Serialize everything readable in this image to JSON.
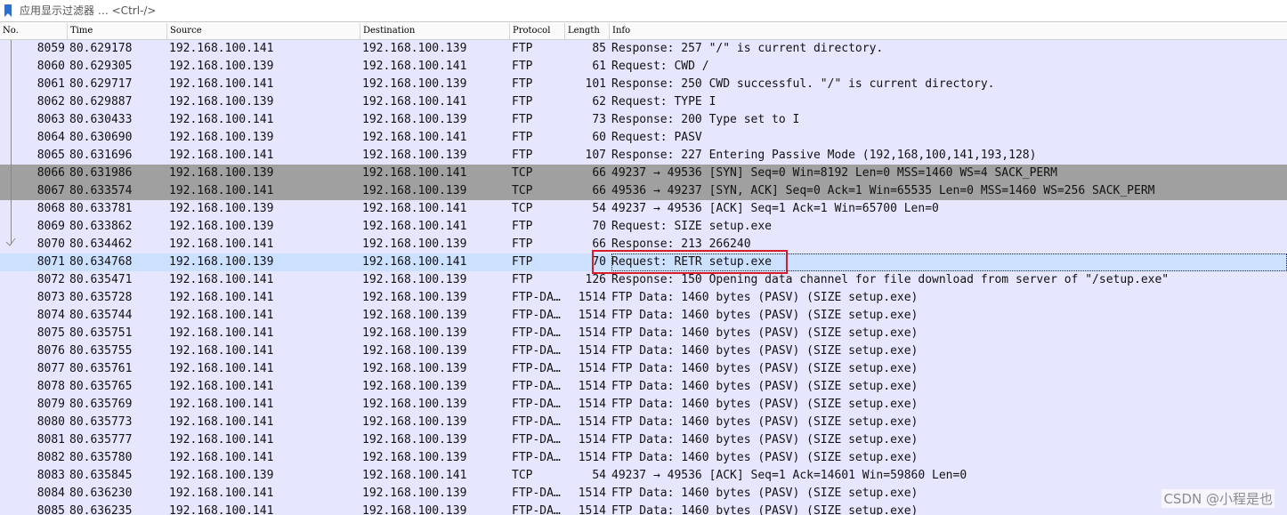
{
  "filter": {
    "placeholder": "应用显示过滤器 … <Ctrl-/>"
  },
  "columns": [
    "No.",
    "Time",
    "Source",
    "Destination",
    "Protocol",
    "Length",
    "Info"
  ],
  "packets": [
    {
      "no": "8059",
      "time": "80.629178",
      "src": "192.168.100.141",
      "dst": "192.168.100.139",
      "proto": "FTP",
      "len": "85",
      "info": "Response: 257 \"/\" is current directory."
    },
    {
      "no": "8060",
      "time": "80.629305",
      "src": "192.168.100.139",
      "dst": "192.168.100.141",
      "proto": "FTP",
      "len": "61",
      "info": "Request: CWD /"
    },
    {
      "no": "8061",
      "time": "80.629717",
      "src": "192.168.100.141",
      "dst": "192.168.100.139",
      "proto": "FTP",
      "len": "101",
      "info": "Response: 250 CWD successful. \"/\" is current directory."
    },
    {
      "no": "8062",
      "time": "80.629887",
      "src": "192.168.100.139",
      "dst": "192.168.100.141",
      "proto": "FTP",
      "len": "62",
      "info": "Request: TYPE I"
    },
    {
      "no": "8063",
      "time": "80.630433",
      "src": "192.168.100.141",
      "dst": "192.168.100.139",
      "proto": "FTP",
      "len": "73",
      "info": "Response: 200 Type set to I"
    },
    {
      "no": "8064",
      "time": "80.630690",
      "src": "192.168.100.139",
      "dst": "192.168.100.141",
      "proto": "FTP",
      "len": "60",
      "info": "Request: PASV"
    },
    {
      "no": "8065",
      "time": "80.631696",
      "src": "192.168.100.141",
      "dst": "192.168.100.139",
      "proto": "FTP",
      "len": "107",
      "info": "Response: 227 Entering Passive Mode (192,168,100,141,193,128)"
    },
    {
      "no": "8066",
      "time": "80.631986",
      "src": "192.168.100.139",
      "dst": "192.168.100.141",
      "proto": "TCP",
      "len": "66",
      "info": "49237 → 49536 [SYN] Seq=0 Win=8192 Len=0 MSS=1460 WS=4 SACK_PERM"
    },
    {
      "no": "8067",
      "time": "80.633574",
      "src": "192.168.100.141",
      "dst": "192.168.100.139",
      "proto": "TCP",
      "len": "66",
      "info": "49536 → 49237 [SYN, ACK] Seq=0 Ack=1 Win=65535 Len=0 MSS=1460 WS=256 SACK_PERM"
    },
    {
      "no": "8068",
      "time": "80.633781",
      "src": "192.168.100.139",
      "dst": "192.168.100.141",
      "proto": "TCP",
      "len": "54",
      "info": "49237 → 49536 [ACK] Seq=1 Ack=1 Win=65700 Len=0"
    },
    {
      "no": "8069",
      "time": "80.633862",
      "src": "192.168.100.139",
      "dst": "192.168.100.141",
      "proto": "FTP",
      "len": "70",
      "info": "Request: SIZE setup.exe"
    },
    {
      "no": "8070",
      "time": "80.634462",
      "src": "192.168.100.141",
      "dst": "192.168.100.139",
      "proto": "FTP",
      "len": "66",
      "info": "Response: 213 266240"
    },
    {
      "no": "8071",
      "time": "80.634768",
      "src": "192.168.100.139",
      "dst": "192.168.100.141",
      "proto": "FTP",
      "len": "70",
      "info": "Request: RETR setup.exe"
    },
    {
      "no": "8072",
      "time": "80.635471",
      "src": "192.168.100.141",
      "dst": "192.168.100.139",
      "proto": "FTP",
      "len": "126",
      "info": "Response: 150 Opening data channel for file download from server of \"/setup.exe\""
    },
    {
      "no": "8073",
      "time": "80.635728",
      "src": "192.168.100.141",
      "dst": "192.168.100.139",
      "proto": "FTP-DA…",
      "len": "1514",
      "info": "FTP Data: 1460 bytes (PASV) (SIZE setup.exe)"
    },
    {
      "no": "8074",
      "time": "80.635744",
      "src": "192.168.100.141",
      "dst": "192.168.100.139",
      "proto": "FTP-DA…",
      "len": "1514",
      "info": "FTP Data: 1460 bytes (PASV) (SIZE setup.exe)"
    },
    {
      "no": "8075",
      "time": "80.635751",
      "src": "192.168.100.141",
      "dst": "192.168.100.139",
      "proto": "FTP-DA…",
      "len": "1514",
      "info": "FTP Data: 1460 bytes (PASV) (SIZE setup.exe)"
    },
    {
      "no": "8076",
      "time": "80.635755",
      "src": "192.168.100.141",
      "dst": "192.168.100.139",
      "proto": "FTP-DA…",
      "len": "1514",
      "info": "FTP Data: 1460 bytes (PASV) (SIZE setup.exe)"
    },
    {
      "no": "8077",
      "time": "80.635761",
      "src": "192.168.100.141",
      "dst": "192.168.100.139",
      "proto": "FTP-DA…",
      "len": "1514",
      "info": "FTP Data: 1460 bytes (PASV) (SIZE setup.exe)"
    },
    {
      "no": "8078",
      "time": "80.635765",
      "src": "192.168.100.141",
      "dst": "192.168.100.139",
      "proto": "FTP-DA…",
      "len": "1514",
      "info": "FTP Data: 1460 bytes (PASV) (SIZE setup.exe)"
    },
    {
      "no": "8079",
      "time": "80.635769",
      "src": "192.168.100.141",
      "dst": "192.168.100.139",
      "proto": "FTP-DA…",
      "len": "1514",
      "info": "FTP Data: 1460 bytes (PASV) (SIZE setup.exe)"
    },
    {
      "no": "8080",
      "time": "80.635773",
      "src": "192.168.100.141",
      "dst": "192.168.100.139",
      "proto": "FTP-DA…",
      "len": "1514",
      "info": "FTP Data: 1460 bytes (PASV) (SIZE setup.exe)"
    },
    {
      "no": "8081",
      "time": "80.635777",
      "src": "192.168.100.141",
      "dst": "192.168.100.139",
      "proto": "FTP-DA…",
      "len": "1514",
      "info": "FTP Data: 1460 bytes (PASV) (SIZE setup.exe)"
    },
    {
      "no": "8082",
      "time": "80.635780",
      "src": "192.168.100.141",
      "dst": "192.168.100.139",
      "proto": "FTP-DA…",
      "len": "1514",
      "info": "FTP Data: 1460 bytes (PASV) (SIZE setup.exe)"
    },
    {
      "no": "8083",
      "time": "80.635845",
      "src": "192.168.100.139",
      "dst": "192.168.100.141",
      "proto": "TCP",
      "len": "54",
      "info": "49237 → 49536 [ACK] Seq=1 Ack=14601 Win=59860 Len=0"
    },
    {
      "no": "8084",
      "time": "80.636230",
      "src": "192.168.100.141",
      "dst": "192.168.100.139",
      "proto": "FTP-DA…",
      "len": "1514",
      "info": "FTP Data: 1460 bytes (PASV) (SIZE setup.exe)"
    },
    {
      "no": "8085",
      "time": "80.636235",
      "src": "192.168.100.141",
      "dst": "192.168.100.139",
      "proto": "FTP-DA…",
      "len": "1514",
      "info": "FTP Data: 1460 bytes (PASV) (SIZE setup.exe)"
    }
  ],
  "selected_no": "8071",
  "syn_rows": [
    "8066",
    "8067"
  ],
  "watermark": "CSDN @小程是也",
  "colors": {
    "row_bg": "#e7e6ff",
    "syn_bg": "#a0a0a0",
    "selected_bg": "#cce0ff",
    "highlight_border": "#d91c2a",
    "bookmark": "#2a6fd6"
  }
}
